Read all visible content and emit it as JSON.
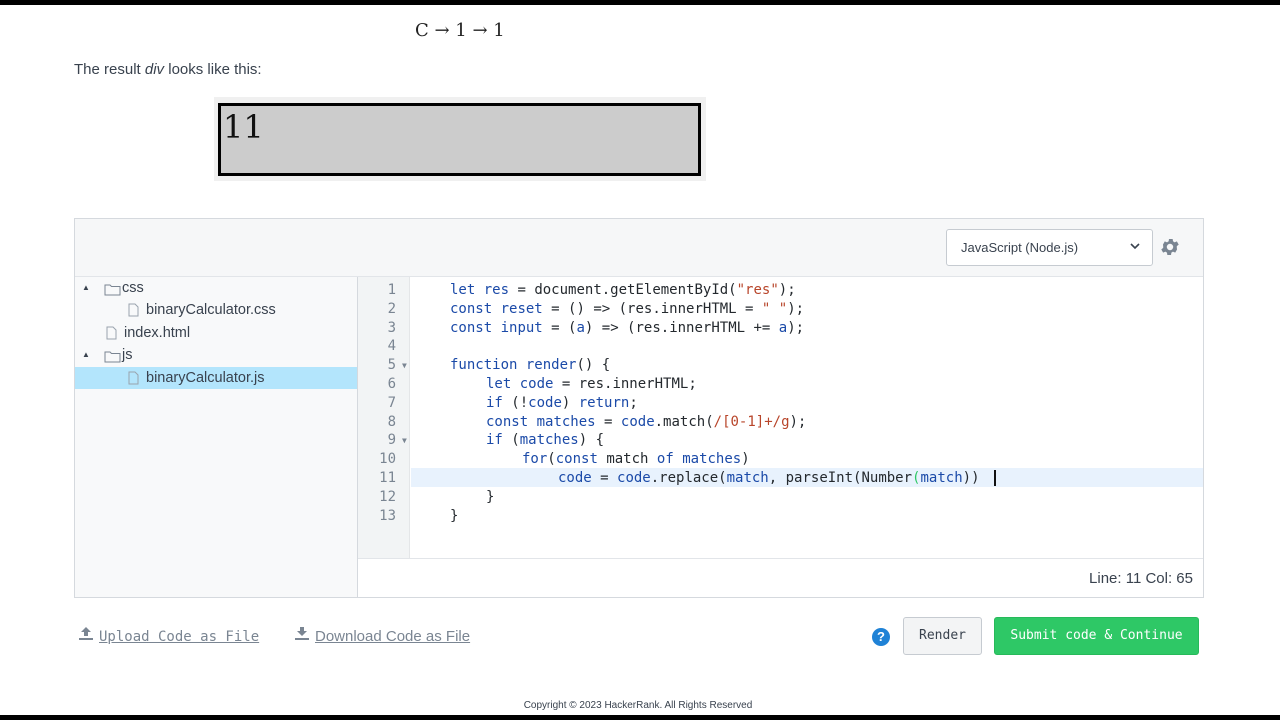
{
  "problem": {
    "formula": "C → 1 → 1",
    "result_prefix": "The result ",
    "result_em": "div",
    "result_suffix": " looks like this:",
    "result_value": "11"
  },
  "editor": {
    "language": "JavaScript (Node.js)",
    "tree": [
      {
        "label": "css",
        "type": "folder"
      },
      {
        "label": "binaryCalculator.css",
        "type": "file"
      },
      {
        "label": "index.html",
        "type": "file"
      },
      {
        "label": "js",
        "type": "folder"
      },
      {
        "label": "binaryCalculator.js",
        "type": "file",
        "selected": true
      }
    ],
    "line_numbers": [
      "1",
      "2",
      "3",
      "4",
      "5",
      "6",
      "7",
      "8",
      "9",
      "10",
      "11",
      "12",
      "13"
    ],
    "status": "Line: 11 Col: 65"
  },
  "footer": {
    "upload": "Upload Code as File",
    "download": "Download Code as File",
    "render": "Render",
    "submit": "Submit code & Continue",
    "help": "?",
    "copyright": "Copyright © 2023 HackerRank. All Rights Reserved"
  },
  "code": {
    "l1": {
      "t1": "let",
      "t2": "res",
      "t3": " = document.getElementById(",
      "t4": "\"res\"",
      "t5": ");"
    },
    "l2": {
      "t1": "const",
      "t2": "reset",
      "t3": " = () => (res.innerHTML = ",
      "t4": "\" \"",
      "t5": ");"
    },
    "l3": {
      "t1": "const",
      "t2": "input",
      "t3": " = (",
      "t4": "a",
      "t5": ") => (res.innerHTML += ",
      "t6": "a",
      "t7": ");"
    },
    "l5": {
      "t1": "function",
      "t2": "render",
      "t3": "() {"
    },
    "l6": {
      "t1": "let",
      "t2": "code",
      "t3": " = res.innerHTML;"
    },
    "l7": {
      "t1": "if",
      "t2": " (!",
      "t3": "code",
      "t4": ") ",
      "t5": "return",
      "t6": ";"
    },
    "l8": {
      "t1": "const",
      "t2": "matches",
      "t3": " = ",
      "t4": "code",
      "t5": ".match(",
      "t6": "/[0-1]+/g",
      "t7": ");"
    },
    "l9": {
      "t1": "if",
      "t2": " (",
      "t3": "matches",
      "t4": ") {"
    },
    "l10": {
      "t1": "for",
      "t2": "(",
      "t3": "const",
      "t4": "match",
      "t5": "of",
      "t6": "matches",
      "t7": ")"
    },
    "l11": {
      "t1": "code",
      "t2": " = ",
      "t3": "code",
      "t4": ".replace(",
      "t5": "match",
      "t6": ", parseInt(Number",
      "t7": "(",
      "t8": "match",
      "t9": "))"
    },
    "l12": "}",
    "l13": "}"
  },
  "colors": {
    "keyword": "#1b4aa8",
    "variable": "#1b4aa8",
    "string": "#b8452a",
    "regex": "#b8452a",
    "accent_green": "#2ec866",
    "selection": "#b3e5fc"
  },
  "icons": {
    "gear": "gear-icon",
    "folder": "folder-icon",
    "file": "file-icon",
    "upload": "upload-icon",
    "download": "download-icon",
    "help": "help-icon"
  }
}
